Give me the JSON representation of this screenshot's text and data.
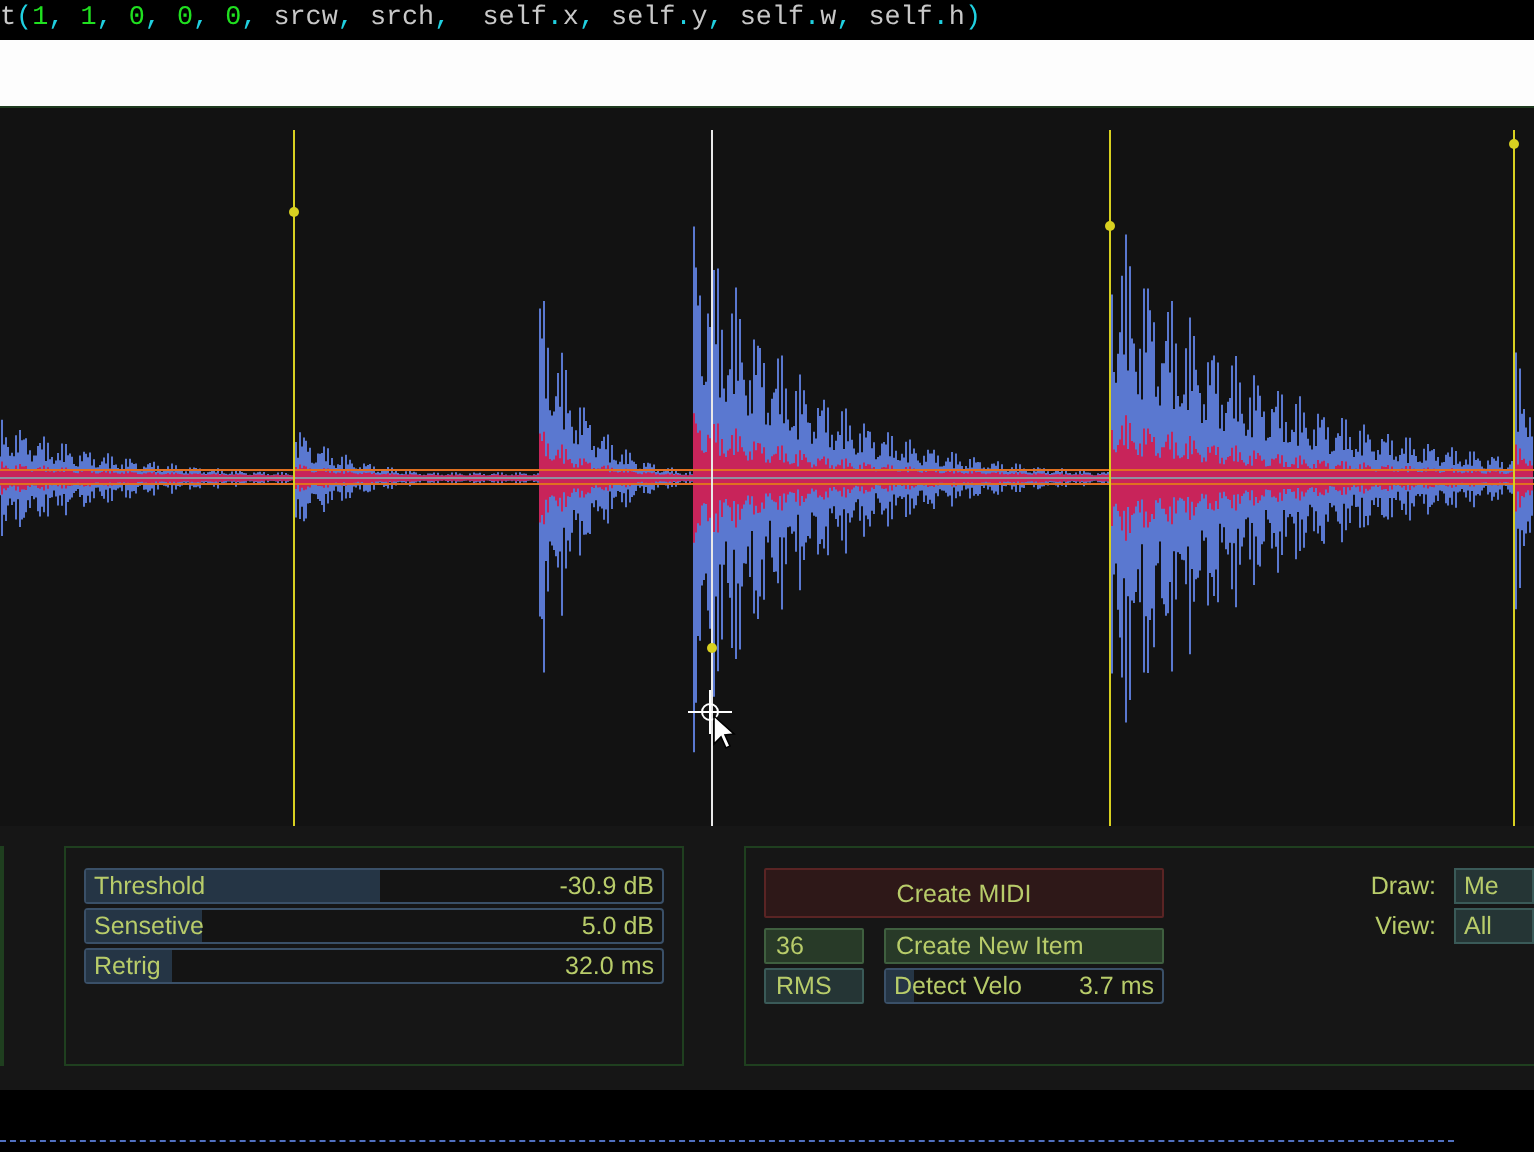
{
  "code_line": [
    {
      "kind": "plain",
      "text": "t"
    },
    {
      "kind": "punct",
      "text": "("
    },
    {
      "kind": "number",
      "text": "1"
    },
    {
      "kind": "punct",
      "text": ", "
    },
    {
      "kind": "number",
      "text": "1"
    },
    {
      "kind": "punct",
      "text": ", "
    },
    {
      "kind": "number",
      "text": "0"
    },
    {
      "kind": "punct",
      "text": ", "
    },
    {
      "kind": "number",
      "text": "0"
    },
    {
      "kind": "punct",
      "text": ", "
    },
    {
      "kind": "number",
      "text": "0"
    },
    {
      "kind": "punct",
      "text": ", "
    },
    {
      "kind": "plain",
      "text": "srcw"
    },
    {
      "kind": "punct",
      "text": ", "
    },
    {
      "kind": "plain",
      "text": "srch"
    },
    {
      "kind": "punct",
      "text": ",  "
    },
    {
      "kind": "plain",
      "text": "self"
    },
    {
      "kind": "punct",
      "text": "."
    },
    {
      "kind": "plain",
      "text": "x"
    },
    {
      "kind": "punct",
      "text": ", "
    },
    {
      "kind": "plain",
      "text": "self"
    },
    {
      "kind": "punct",
      "text": "."
    },
    {
      "kind": "plain",
      "text": "y"
    },
    {
      "kind": "punct",
      "text": ", "
    },
    {
      "kind": "plain",
      "text": "self"
    },
    {
      "kind": "punct",
      "text": "."
    },
    {
      "kind": "plain",
      "text": "w"
    },
    {
      "kind": "punct",
      "text": ", "
    },
    {
      "kind": "plain",
      "text": "self"
    },
    {
      "kind": "punct",
      "text": "."
    },
    {
      "kind": "plain",
      "text": "h"
    },
    {
      "kind": "punct",
      "text": ")"
    }
  ],
  "sliders": [
    {
      "label": "Threshold",
      "reading": "-30.9 dB",
      "level": 0.51
    },
    {
      "label": "Sensetive",
      "reading": "5.0 dB",
      "level": 0.2
    },
    {
      "label": "Retrig",
      "reading": "32.0 ms",
      "level": 0.15
    }
  ],
  "create_midi": "Create MIDI",
  "note_field": "36",
  "create_item": "Create New Item",
  "mode_button": "RMS",
  "velo_slider": {
    "label": "Detect Velo",
    "reading": "3.7 ms",
    "level": 0.1
  },
  "options": [
    {
      "label": "Draw:",
      "value": "Me"
    },
    {
      "label": "View:",
      "value": "All"
    }
  ]
}
